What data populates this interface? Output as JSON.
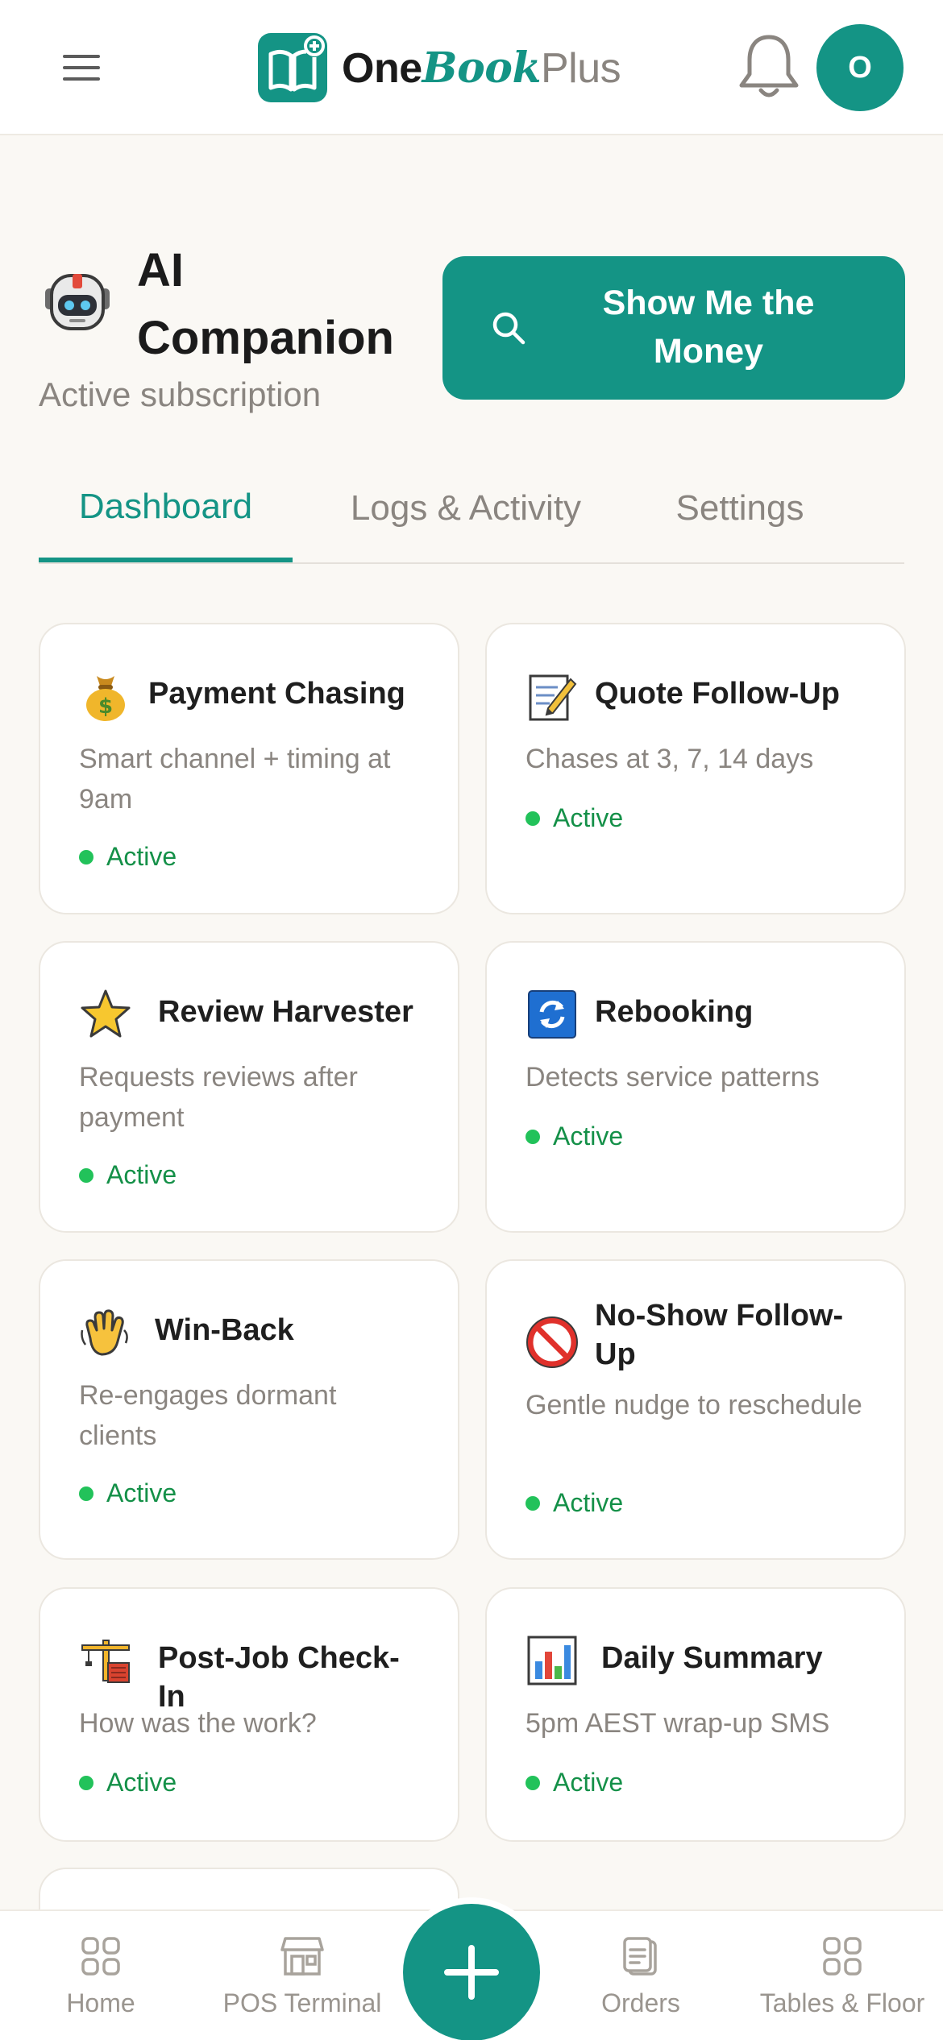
{
  "header": {
    "logo": {
      "one": "One",
      "book": "Book",
      "plus": "Plus"
    },
    "avatar_initial": "O"
  },
  "page": {
    "title": "AI Companion",
    "subtitle": "Active subscription",
    "action_button": "Show Me the Money"
  },
  "tabs": [
    {
      "label": "Dashboard",
      "active": true
    },
    {
      "label": "Logs & Activity",
      "active": false
    },
    {
      "label": "Settings",
      "active": false
    }
  ],
  "cards": [
    {
      "icon": "money-bag-icon",
      "title": "Payment Chasing",
      "description": "Smart channel + timing at 9am",
      "status": "Active"
    },
    {
      "icon": "memo-icon",
      "title": "Quote Follow-Up",
      "description": "Chases at 3, 7, 14 days",
      "status": "Active"
    },
    {
      "icon": "star-icon",
      "title": "Review Harvester",
      "description": "Requests reviews after payment",
      "status": "Active"
    },
    {
      "icon": "refresh-icon",
      "title": "Rebooking",
      "description": "Detects service patterns",
      "status": "Active"
    },
    {
      "icon": "waving-hand-icon",
      "title": "Win-Back",
      "description": "Re-engages dormant clients",
      "status": "Active"
    },
    {
      "icon": "prohibited-icon",
      "title": "No-Show Follow-Up",
      "description": "Gentle nudge to reschedule",
      "status": "Active"
    },
    {
      "icon": "construction-icon",
      "title": "Post-Job Check-In",
      "description": "How was the work?",
      "status": "Active"
    },
    {
      "icon": "bar-chart-icon",
      "title": "Daily Summary",
      "description": "5pm AEST wrap-up SMS",
      "status": "Active"
    }
  ],
  "bottom_nav": [
    {
      "icon": "home-grid-icon",
      "label": "Home"
    },
    {
      "icon": "store-icon",
      "label": "POS Terminal"
    },
    {
      "icon": "plus-icon",
      "label": ""
    },
    {
      "icon": "clipboard-icon",
      "label": "Orders"
    },
    {
      "icon": "grid-icon",
      "label": "Tables & Floor"
    }
  ],
  "colors": {
    "accent": "#149485",
    "status_dot": "#22c25a",
    "status_text": "#149048",
    "background": "#faf8f4"
  }
}
